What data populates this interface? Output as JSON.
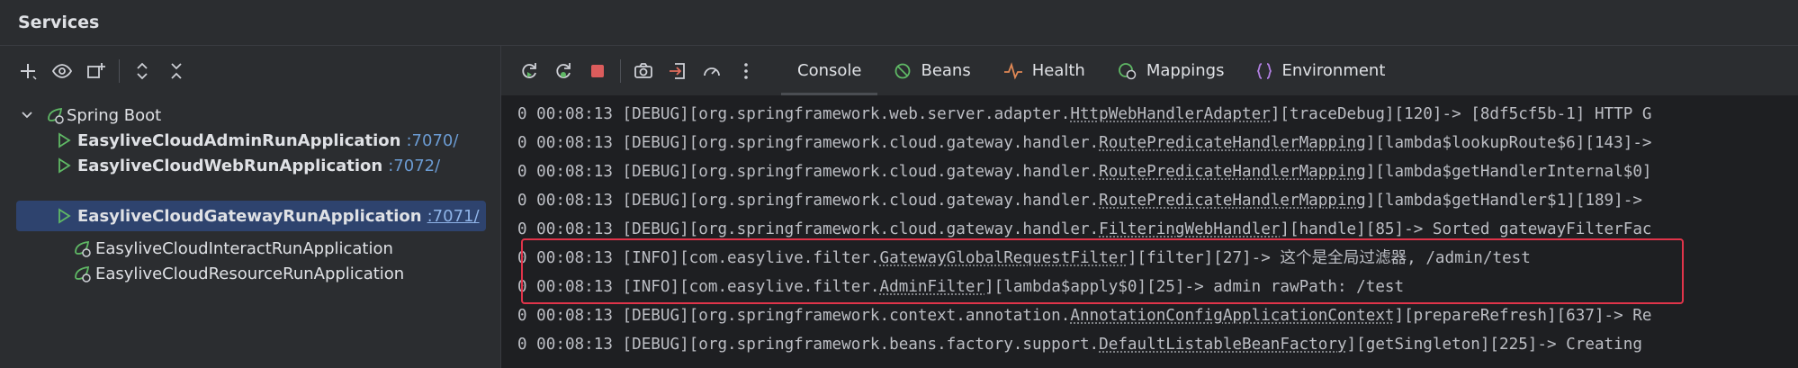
{
  "window": {
    "title": "Services"
  },
  "left_toolbar": {
    "icons": [
      "add-icon",
      "eye-icon",
      "add-group-icon",
      "expand-all-icon",
      "collapse-all-icon"
    ]
  },
  "tree": {
    "root": {
      "label": "Spring Boot",
      "icon": "spring-boot-icon"
    },
    "items": [
      {
        "name": "EasyliveCloudAdminRunApplication",
        "port": ":7070/",
        "running": true,
        "selected": false
      },
      {
        "name": "EasyliveCloudWebRunApplication",
        "port": ":7072/",
        "running": true,
        "selected": false
      },
      {
        "name": "EasyliveCloudGatewayRunApplication",
        "port": ":7071/",
        "running": true,
        "selected": true
      },
      {
        "name": "EasyliveCloudInteractRunApplication",
        "port": "",
        "running": false,
        "selected": false
      },
      {
        "name": "EasyliveCloudResourceRunApplication",
        "port": "",
        "running": false,
        "selected": false
      }
    ]
  },
  "right_toolbar": {
    "icons": [
      "rerun-icon",
      "rerun-debug-icon",
      "stop-icon",
      "camera-icon",
      "exit-icon",
      "gauge-icon",
      "more-icon"
    ]
  },
  "tabs": [
    {
      "label": "Console",
      "active": true
    },
    {
      "label": "Beans",
      "active": false
    },
    {
      "label": "Health",
      "active": false
    },
    {
      "label": "Mappings",
      "active": false
    },
    {
      "label": "Environment",
      "active": false
    }
  ],
  "colors": {
    "accent": "#2e436e",
    "highlight": "#e0344a",
    "run": "#5fb865"
  },
  "console": {
    "lines": [
      {
        "pre": "0 00:08:13 [DEBUG][org.springframework.web.server.adapter.",
        "cls": "HttpWebHandlerAdapter",
        "post": "][traceDebug][120]-> [8df5cf5b-1] HTTP G"
      },
      {
        "pre": "0 00:08:13 [DEBUG][org.springframework.cloud.gateway.handler.",
        "cls": "RoutePredicateHandlerMapping",
        "post": "][lambda$lookupRoute$6][143]->"
      },
      {
        "pre": "0 00:08:13 [DEBUG][org.springframework.cloud.gateway.handler.",
        "cls": "RoutePredicateHandlerMapping",
        "post": "][lambda$getHandlerInternal$0]"
      },
      {
        "pre": "0 00:08:13 [DEBUG][org.springframework.cloud.gateway.handler.",
        "cls": "RoutePredicateHandlerMapping",
        "post": "][lambda$getHandler$1][189]->"
      },
      {
        "pre": "0 00:08:13 [DEBUG][org.springframework.cloud.gateway.handler.",
        "cls": "FilteringWebHandler",
        "post": "][handle][85]-> Sorted gatewayFilterFac"
      },
      {
        "pre": "0 00:08:13 [INFO][com.easylive.filter.",
        "cls": "GatewayGlobalRequestFilter",
        "post": "][filter][27]-> 这个是全局过滤器, /admin/test"
      },
      {
        "pre": "0 00:08:13 [INFO][com.easylive.filter.",
        "cls": "AdminFilter",
        "post": "][lambda$apply$0][25]-> admin rawPath: /test"
      },
      {
        "pre": "0 00:08:13 [DEBUG][org.springframework.context.annotation.",
        "cls": "AnnotationConfigApplicationContext",
        "post": "][prepareRefresh][637]-> Re"
      },
      {
        "pre": "0 00:08:13 [DEBUG][org.springframework.beans.factory.support.",
        "cls": "DefaultListableBeanFactory",
        "post": "][getSingleton][225]-> Creating"
      }
    ]
  }
}
